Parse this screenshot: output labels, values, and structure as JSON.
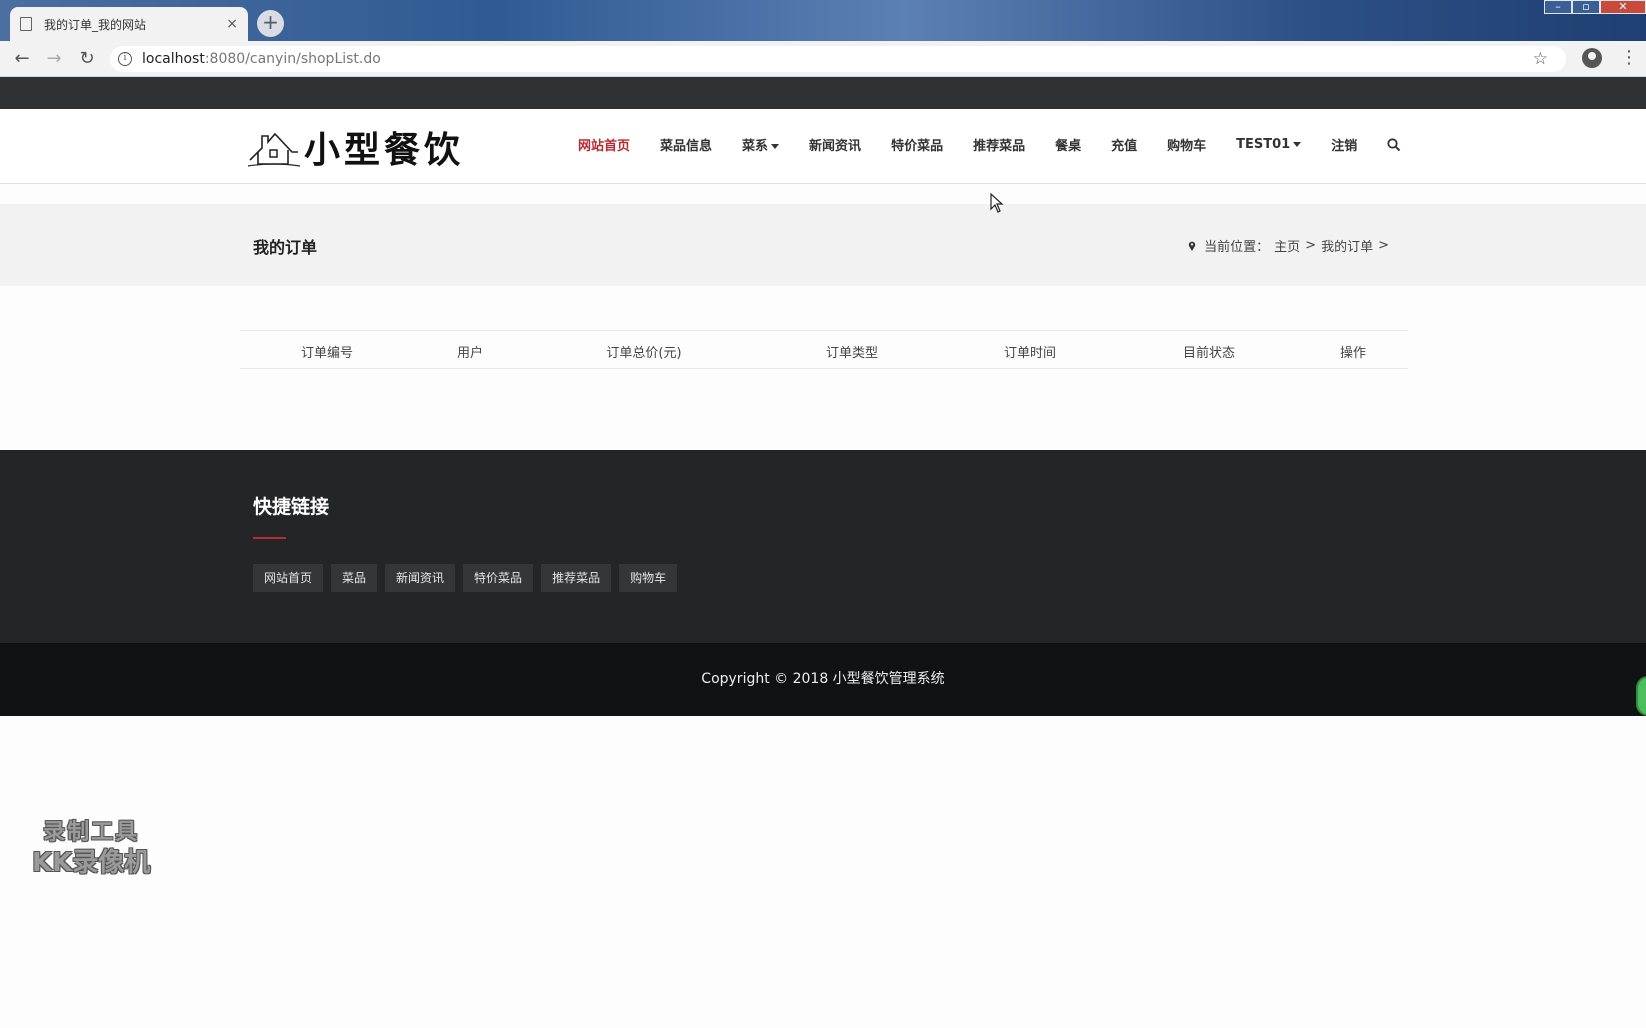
{
  "browser": {
    "tab_title": "我的订单_我的网站",
    "tab_close": "×",
    "new_tab": "+",
    "url_host": "localhost",
    "url_path": ":8080/canyin/shopList.do",
    "back_icon": "←",
    "forward_icon": "→",
    "reload_icon": "↻",
    "info_icon": "i",
    "star_icon": "☆",
    "menu_icon": "⋮",
    "window_controls": [
      "–",
      "▫",
      "✕"
    ]
  },
  "site": {
    "logo_text": "小型餐饮",
    "nav": [
      {
        "label": "网站首页",
        "active": true
      },
      {
        "label": "菜品信息"
      },
      {
        "label": "菜系"
      },
      {
        "label": "新闻资讯"
      },
      {
        "label": "特价菜品"
      },
      {
        "label": "推荐菜品"
      },
      {
        "label": "餐桌"
      },
      {
        "label": "充值"
      },
      {
        "label": "购物车"
      },
      {
        "label": "TEST01"
      },
      {
        "label": "注销"
      }
    ],
    "search_icon": "search-icon",
    "accent_color": "#b52a35"
  },
  "page": {
    "title": "我的订单",
    "breadcrumb": {
      "prefix": "当前位置：",
      "home": "主页",
      "sep": ">",
      "current": "我的订单",
      "trail": ">"
    }
  },
  "orders_table": {
    "columns": [
      "订单编号",
      "用户",
      "订单总价(元)",
      "订单类型",
      "订单时间",
      "目前状态",
      "操作"
    ],
    "rows": []
  },
  "footer": {
    "heading": "快捷链接",
    "links": [
      "网站首页",
      "菜品",
      "新闻资讯",
      "特价菜品",
      "推荐菜品",
      "购物车"
    ],
    "copyright": "Copyright © 2018 小型餐饮管理系统"
  },
  "watermark": {
    "line1": "录制工具",
    "line2": "KK录像机"
  }
}
